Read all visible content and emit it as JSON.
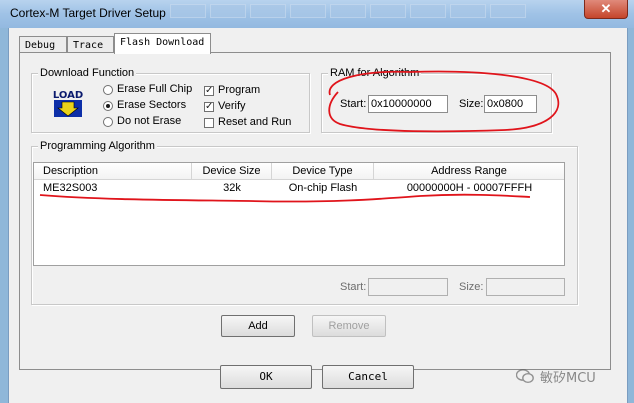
{
  "window": {
    "title": "Cortex-M Target Driver Setup",
    "close_glyph": "✕"
  },
  "tabs": [
    {
      "label": "Debug",
      "active": false
    },
    {
      "label": "Trace",
      "active": false
    },
    {
      "label": "Flash Download",
      "active": true
    }
  ],
  "download_function": {
    "title": "Download Function",
    "icon_text": "LOAD",
    "options": [
      {
        "label": "Erase Full Chip",
        "selected": false
      },
      {
        "label": "Erase Sectors",
        "selected": true
      },
      {
        "label": "Do not Erase",
        "selected": false
      }
    ],
    "checks": [
      {
        "label": "Program",
        "checked": true
      },
      {
        "label": "Verify",
        "checked": true
      },
      {
        "label": "Reset and Run",
        "checked": false
      }
    ]
  },
  "ram": {
    "title": "RAM for Algorithm",
    "start_label": "Start:",
    "start_value": "0x10000000",
    "size_label": "Size:",
    "size_value": "0x0800"
  },
  "programming": {
    "title": "Programming Algorithm",
    "columns": [
      "Description",
      "Device Size",
      "Device Type",
      "Address Range"
    ],
    "rows": [
      {
        "description": "ME32S003",
        "size": "32k",
        "type": "On-chip Flash",
        "range": "00000000H - 00007FFFH"
      }
    ],
    "start_label": "Start:",
    "start_value": "",
    "size_label": "Size:",
    "size_value": ""
  },
  "buttons": {
    "add": "Add",
    "remove": "Remove",
    "ok": "OK",
    "cancel": "Cancel"
  },
  "watermark": {
    "text": "敏矽MCU"
  },
  "colors": {
    "annotation": "#e0141b",
    "titlebar": "#a7c8e8",
    "close": "#c9482d"
  }
}
